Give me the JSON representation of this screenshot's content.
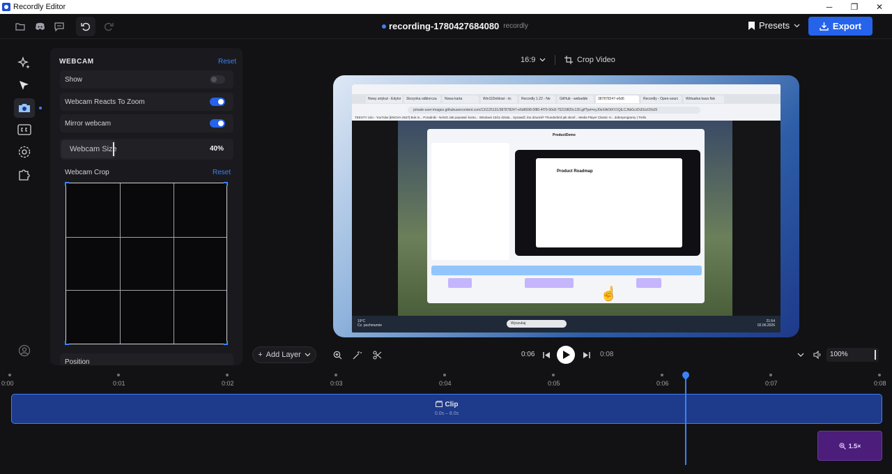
{
  "window": {
    "title": "Recordly Editor",
    "minimize": "─",
    "maximize": "❐",
    "close": "✕"
  },
  "toolbar": {
    "recording_name": "recording-1780427684080",
    "recording_app": "recordly",
    "presets_label": "Presets",
    "export_label": "Export"
  },
  "sidebar": {
    "items": [
      {
        "name": "effects",
        "icon": "sparkles-icon"
      },
      {
        "name": "cursor",
        "icon": "cursor-arrow-icon"
      },
      {
        "name": "webcam",
        "icon": "camera-icon",
        "active": true
      },
      {
        "name": "captions",
        "icon": "cc-icon"
      },
      {
        "name": "settings",
        "icon": "gear-icon"
      },
      {
        "name": "extensions",
        "icon": "puzzle-icon"
      }
    ],
    "account_icon": "user-circle-icon"
  },
  "panel": {
    "title": "WEBCAM",
    "reset_label": "Reset",
    "show_label": "Show",
    "show_on": false,
    "reacts_zoom_label": "Webcam Reacts To Zoom",
    "reacts_zoom_on": true,
    "mirror_label": "Mirror webcam",
    "mirror_on": true,
    "size_label": "Webcam Size",
    "size_value": "40%",
    "crop_label": "Webcam Crop",
    "crop_reset_label": "Reset",
    "position_label": "Position"
  },
  "preview": {
    "aspect_ratio": "16:9",
    "crop_video_label": "Crop Video",
    "browser_tabs": [
      "Nowy artykuł - Edytor",
      "Skrzynka odbiorcza",
      "Nowa karta",
      "Win11Debloat - ric",
      "Recordly 1.22 - Ne",
      "GitHub - webadde",
      "387878247-e6d6",
      "Recordly - Open-sourc",
      "Wirtualna kasa fisk"
    ],
    "url": "private-user-images.githubusercontent.com/131125131/387878247-e6d6698-5f80-4f70-90c8-75219820c130.gif?jwt=eyJ0eXAiOiKV1QiLCJhbGciOiJIUzI1NiJ9",
    "bookmarks": "TEESTY   zolo - YouTube   [ENOVA-2527] Bok m...   Poradniki - NANO   Jak poprawić konto...   Windows 10/11 dziala...   Sprawdź, kto dzwonił?   Thunderbird jak skonf...   Media Player Classic H...   dobreprogramy | Trello",
    "inner_title": "Product Roadmap",
    "inner_app_title": "ProductDemo",
    "taskbar_weather_temp": "19°C",
    "taskbar_weather_desc": "Cz. pochmurnie",
    "taskbar_search": "Wyszukaj",
    "taskbar_time": "21:54",
    "taskbar_date": "02.06.2026"
  },
  "controls": {
    "add_layer_label": "Add Layer",
    "current_time": "0:06",
    "end_time": "0:08",
    "zoom_value": "100%"
  },
  "timeline": {
    "ticks": [
      "0:00",
      "0:01",
      "0:02",
      "0:03",
      "0:04",
      "0:05",
      "0:06",
      "0:07",
      "0:08"
    ],
    "clip_label": "Clip",
    "clip_range": "0.0s – 8.0s",
    "zoom_clip_label": "1.5×",
    "playhead_time": 6.1
  },
  "colors": {
    "accent": "#2563eb",
    "zoom_clip": "#4c1d7a",
    "clip": "#1e3a8a"
  }
}
